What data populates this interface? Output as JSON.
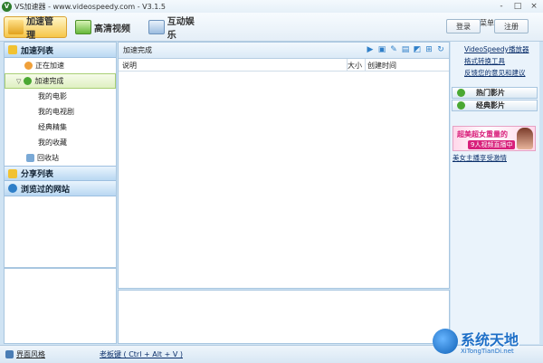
{
  "window": {
    "title": "VS加速器 - www.videospeedy.com - V3.1.5",
    "controls": [
      "-",
      "□",
      "×"
    ]
  },
  "tabs": [
    {
      "label": "加速管理",
      "active": true
    },
    {
      "label": "高清视频",
      "active": false
    },
    {
      "label": "互动娱乐",
      "active": false
    }
  ],
  "user": {
    "name": "菜单"
  },
  "buttons": {
    "login": "登录",
    "register": "注册"
  },
  "sidebar": {
    "group1": "加速列表",
    "items": [
      "正在加速",
      "加速完成",
      "我的电影",
      "我的电视剧",
      "经典精集",
      "我的收藏",
      "回收站"
    ],
    "group2": "分享列表",
    "group3": "浏览过的网站"
  },
  "main": {
    "header": "加速完成",
    "columns": {
      "desc": "说明",
      "size": "大小",
      "created": "创建时间"
    }
  },
  "right": {
    "links": [
      "VideoSpeedy播放器",
      "格式转换工具",
      "反馈您的意见和建议"
    ],
    "hot": "热门影片",
    "classic": "经典影片",
    "banner_line1": "超美超女重量的",
    "banner_line2": "9人视频直播中",
    "banner_link": "美女主播享受激情"
  },
  "status": {
    "skin": "界面风格",
    "hotkey": "老板键 ( Ctrl + Alt + V )"
  },
  "watermark": {
    "title": "系统天地",
    "url": "XiTongTianDi.net"
  }
}
